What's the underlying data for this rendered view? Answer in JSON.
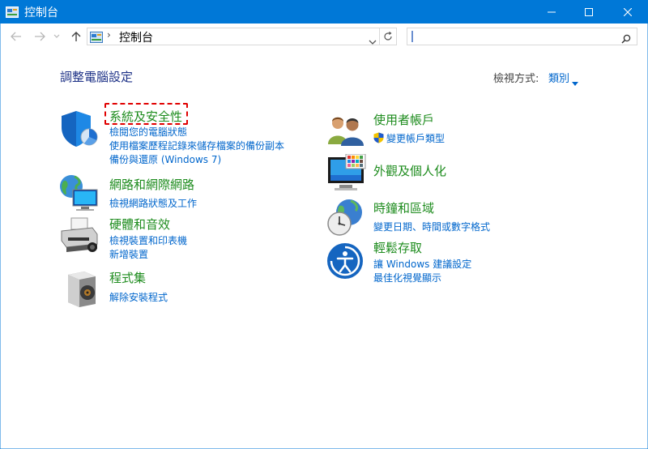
{
  "window": {
    "title": "控制台"
  },
  "address": {
    "separator": "›",
    "path": "控制台",
    "search_value": ""
  },
  "main": {
    "heading": "調整電腦設定",
    "view_by_label": "檢視方式:",
    "view_by_value": "類別"
  },
  "categories": {
    "system": {
      "title": "系統及安全性",
      "links": [
        "檢閱您的電腦狀態",
        "使用檔案歷程記錄來儲存檔案的備份副本",
        "備份與還原 (Windows 7)"
      ]
    },
    "network": {
      "title": "網路和網際網路",
      "links": [
        "檢視網路狀態及工作"
      ]
    },
    "hardware": {
      "title": "硬體和音效",
      "links": [
        "檢視裝置和印表機",
        "新增裝置"
      ]
    },
    "programs": {
      "title": "程式集",
      "links": [
        "解除安裝程式"
      ]
    },
    "users": {
      "title": "使用者帳戶",
      "links": [
        "變更帳戶類型"
      ]
    },
    "appearance": {
      "title": "外觀及個人化",
      "links": []
    },
    "clock": {
      "title": "時鐘和區域",
      "links": [
        "變更日期、時間或數字格式"
      ]
    },
    "ease": {
      "title": "輕鬆存取",
      "links": [
        "讓 Windows 建議設定",
        "最佳化視覺顯示"
      ]
    }
  },
  "colors": {
    "titlebar": "#0078d7",
    "category_title": "#1e8c1e",
    "link": "#0066cc",
    "heading": "#1e3287",
    "highlight": "#e00000"
  }
}
